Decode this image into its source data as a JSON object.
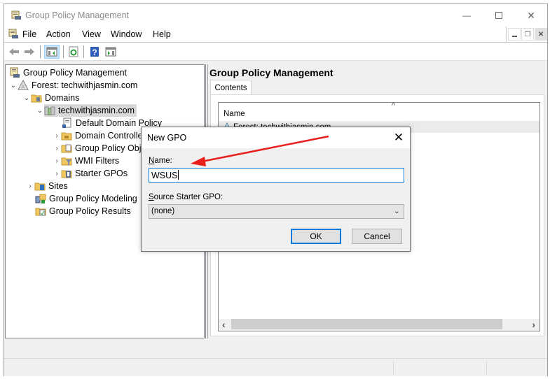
{
  "window": {
    "title": "Group Policy Management",
    "controls": {
      "minimize": "—",
      "maximize": "☐",
      "close": "✕"
    }
  },
  "menubar": {
    "items": [
      "File",
      "Action",
      "View",
      "Window",
      "Help"
    ],
    "mdi_controls": {
      "minimize": "▁",
      "restore": "❐",
      "close": "✕"
    }
  },
  "toolbar": {
    "buttons": [
      "back-icon",
      "forward-icon",
      "show-hide-console-tree-icon",
      "refresh-icon",
      "help-icon",
      "show-hide-action-pane-icon"
    ]
  },
  "tree": {
    "items": [
      {
        "label": "Group Policy Management",
        "icon": "gpm-icon",
        "expander": ""
      },
      {
        "label": "Forest: techwithjasmin.com",
        "icon": "forest-icon",
        "expander": "expanded"
      },
      {
        "label": "Domains",
        "icon": "domains-folder-icon",
        "expander": "expanded"
      },
      {
        "label": "techwithjasmin.com",
        "icon": "domain-icon",
        "expander": "expanded",
        "selected": true
      },
      {
        "label": "Default Domain Policy",
        "icon": "gpo-link-icon",
        "expander": ""
      },
      {
        "label": "Domain Controllers",
        "icon": "ou-folder-icon",
        "expander": "collapsed"
      },
      {
        "label": "Group Policy Objects",
        "icon": "gpo-folder-icon",
        "expander": "collapsed"
      },
      {
        "label": "WMI Filters",
        "icon": "wmi-folder-icon",
        "expander": "collapsed"
      },
      {
        "label": "Starter GPOs",
        "icon": "starter-folder-icon",
        "expander": "collapsed"
      },
      {
        "label": "Sites",
        "icon": "sites-folder-icon",
        "expander": "collapsed"
      },
      {
        "label": "Group Policy Modeling",
        "icon": "modeling-icon",
        "expander": ""
      },
      {
        "label": "Group Policy Results",
        "icon": "results-icon",
        "expander": ""
      }
    ]
  },
  "right_pane": {
    "title": "Group Policy Management",
    "tab": "Contents",
    "list": {
      "column_header": "Name",
      "sort_indicator": "^",
      "rows": [
        "Forest: techwithjasmin.com"
      ]
    },
    "scroll_left": "‹",
    "scroll_right": "›"
  },
  "dialog": {
    "title": "New GPO",
    "close": "✕",
    "name_label_accel": "N",
    "name_label_rest": "ame:",
    "name_value": "WSUS",
    "source_label_accel": "S",
    "source_label_rest": "ource Starter GPO:",
    "source_value": "(none)",
    "ok_label": "OK",
    "cancel_label": "Cancel"
  },
  "annotation": {
    "arrow_color": "#e8201c"
  }
}
